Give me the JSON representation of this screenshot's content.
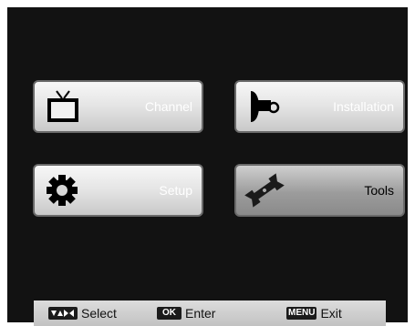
{
  "menu": {
    "items": [
      {
        "label": "Channel",
        "icon": "tv-icon"
      },
      {
        "label": "Installation",
        "icon": "satellite-dish-icon"
      },
      {
        "label": "Setup",
        "icon": "gear-icon"
      },
      {
        "label": "Tools",
        "icon": "wrench-icon"
      }
    ]
  },
  "hints": {
    "select_label": "Select",
    "enter_key": "OK",
    "enter_label": "Enter",
    "exit_key": "MENU",
    "exit_label": "Exit"
  },
  "colors": {
    "screen_background": "#121212",
    "tile_light": "#f7f7f7",
    "tile_selected": "#9c9c9c",
    "hint_bar": "#cfcfcf"
  }
}
